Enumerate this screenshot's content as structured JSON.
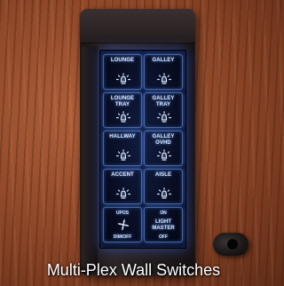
{
  "caption": "Multi-Plex Wall Switches",
  "colors": {
    "panel_glow": "#3c6eff",
    "label_text": "#d8e6ff",
    "wood": "#8a4426"
  },
  "icon": "light-bulb-icon",
  "switches": [
    {
      "label": "LOUNGE"
    },
    {
      "label": "GALLEY"
    },
    {
      "label": "LOUNGE\nTRAY"
    },
    {
      "label": "GALLEY\nTRAY"
    },
    {
      "label": "HALLWAY"
    },
    {
      "label": "GALLEY\nOVHD"
    },
    {
      "label": "ACCENT"
    },
    {
      "label": "AISLE"
    }
  ],
  "bottom_left": {
    "top": "UPOS",
    "bottom": "DIM/OFF"
  },
  "bottom_right": {
    "top": "ON",
    "middle": "LIGHT\nMASTER",
    "bottom": "OFF"
  }
}
